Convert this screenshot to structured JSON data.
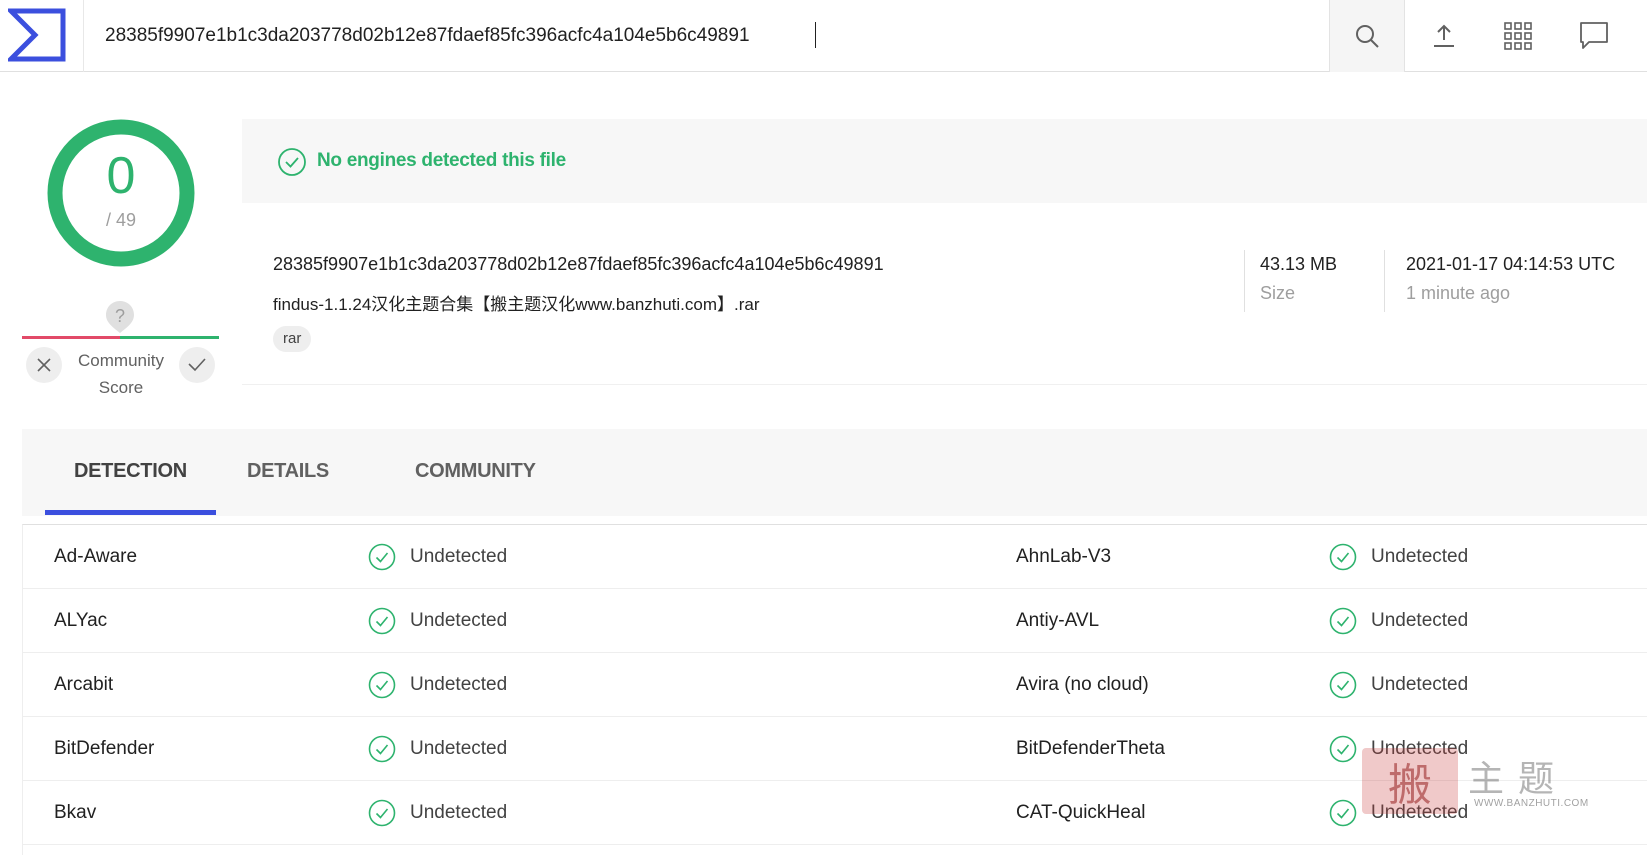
{
  "search": {
    "value": "28385f9907e1b1c3da203778d02b12e87fdaef85fc396acfc4a104e5b6c49891"
  },
  "score": {
    "detections": "0",
    "total": "/ 49"
  },
  "community": {
    "marker": "?",
    "label_line1": "Community",
    "label_line2": "Score"
  },
  "banner": {
    "text": "No engines detected this file"
  },
  "file": {
    "hash": "28385f9907e1b1c3da203778d02b12e87fdaef85fc396acfc4a104e5b6c49891",
    "name": "findus-1.1.24汉化主题合集【搬主题汉化www.banzhuti.com】.rar",
    "tag": "rar",
    "size_value": "43.13 MB",
    "size_label": "Size",
    "date_value": "2021-01-17 04:14:53 UTC",
    "date_label": "1 minute ago"
  },
  "tabs": [
    {
      "label": "DETECTION"
    },
    {
      "label": "DETAILS"
    },
    {
      "label": "COMMUNITY"
    }
  ],
  "results": [
    {
      "left_engine": "Ad-Aware",
      "left_result": "Undetected",
      "right_engine": "AhnLab-V3",
      "right_result": "Undetected"
    },
    {
      "left_engine": "ALYac",
      "left_result": "Undetected",
      "right_engine": "Antiy-AVL",
      "right_result": "Undetected"
    },
    {
      "left_engine": "Arcabit",
      "left_result": "Undetected",
      "right_engine": "Avira (no cloud)",
      "right_result": "Undetected"
    },
    {
      "left_engine": "BitDefender",
      "left_result": "Undetected",
      "right_engine": "BitDefenderTheta",
      "right_result": "Undetected"
    },
    {
      "left_engine": "Bkav",
      "left_result": "Undetected",
      "right_engine": "CAT-QuickHeal",
      "right_result": "Undetected"
    }
  ],
  "watermark": {
    "stamp": "搬",
    "title": "主题",
    "url": "WWW.BANZHUTI.COM"
  },
  "colors": {
    "clean": "#2eb36e",
    "malicious": "#e24a68",
    "accent": "#3b4fde"
  },
  "icons": [
    "virustotal-logo",
    "search-icon",
    "upload-icon",
    "apps-grid-icon",
    "chat-icon",
    "check-circle-icon",
    "close-icon",
    "check-icon",
    "question-marker-icon"
  ]
}
